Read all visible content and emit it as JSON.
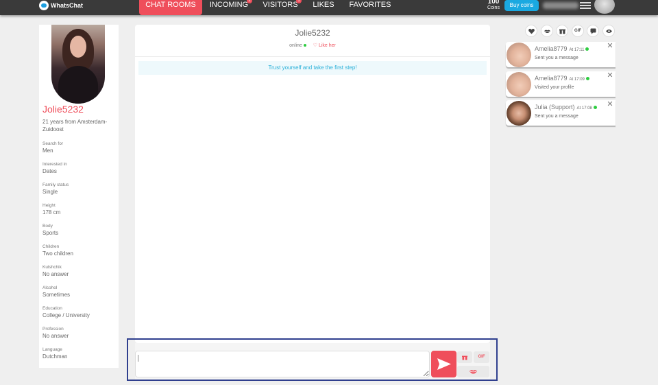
{
  "app": {
    "name": "WhatsChat"
  },
  "nav": {
    "items": [
      {
        "label": "CHAT ROOMS",
        "active": true
      },
      {
        "label": "INCOMING",
        "badge": "2"
      },
      {
        "label": "VISITORS",
        "badge": "1"
      },
      {
        "label": "LIKES"
      },
      {
        "label": "FAVORITES"
      }
    ]
  },
  "account": {
    "coins_value": "100",
    "coins_label": "Coins",
    "buy_label": "Buy coins"
  },
  "profile": {
    "name": "Jolie5232",
    "summary": "21 years from Amsterdam-Zuidoost",
    "attributes": [
      {
        "label": "Search for",
        "value": "Men"
      },
      {
        "label": "Interested in",
        "value": "Dates"
      },
      {
        "label": "Family status",
        "value": "Single"
      },
      {
        "label": "Height",
        "value": "178 cm"
      },
      {
        "label": "Body",
        "value": "Sports"
      },
      {
        "label": "Children",
        "value": "Two children"
      },
      {
        "label": "Kulshchik",
        "value": "No answer"
      },
      {
        "label": "Alcohol",
        "value": "Sometimes"
      },
      {
        "label": "Education",
        "value": "College / University"
      },
      {
        "label": "Profession",
        "value": "No answer"
      },
      {
        "label": "Language",
        "value": "Dutchman"
      }
    ]
  },
  "chat": {
    "title": "Jolie5232",
    "status": "online",
    "like_label": "Like her",
    "banner": "Trust yourself and take the first step!",
    "input_value": "",
    "gif_label": "GIF"
  },
  "quick_actions": {
    "icons": [
      "heart-icon",
      "kiss-icon",
      "gift-icon",
      "gif-icon",
      "chat-icon",
      "eye-icon"
    ],
    "gif_label": "GIF"
  },
  "notifications": [
    {
      "name": "Amelia8779",
      "time": "At 17:11",
      "text": "Sent you a message"
    },
    {
      "name": "Amelia8779",
      "time": "At 17:09",
      "text": "Visited your profile"
    },
    {
      "name": "Julia (Support)",
      "time": "At 17:08",
      "text": "Sent you a message"
    }
  ],
  "colors": {
    "accent": "#ef4e5b",
    "topbar": "#3a3a3a",
    "buy_button": "#1aa9e1",
    "banner_text": "#2ab0d8",
    "online": "#2ecc40"
  }
}
